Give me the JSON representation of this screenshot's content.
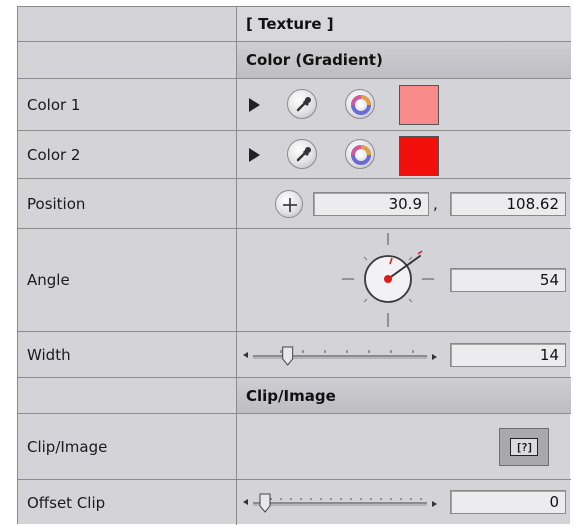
{
  "sections": {
    "texture_header": "[ Texture ]",
    "gradient_header": "Color (Gradient)",
    "clip_header": "Clip/Image"
  },
  "color1": {
    "label": "Color 1",
    "swatch_color": "#f98a8a"
  },
  "color2": {
    "label": "Color 2",
    "swatch_color": "#f10f0b"
  },
  "position": {
    "label": "Position",
    "x": "30.9",
    "separator": ",",
    "y": "108.62"
  },
  "angle": {
    "label": "Angle",
    "value": "54"
  },
  "width": {
    "label": "Width",
    "value": "14",
    "slider_fraction": 0.14
  },
  "clip_image": {
    "label": "Clip/Image",
    "button_glyph": "[?]"
  },
  "offset_clip": {
    "label": "Offset Clip",
    "value": "0",
    "slider_fraction": 0.0
  },
  "icons": {
    "disclosure": "disclosure-triangle-icon",
    "eyedropper": "eyedropper-icon",
    "color_wheel": "color-wheel-icon",
    "crosshair": "plus-crosshair-icon",
    "dial": "angle-dial-icon",
    "slider": "slider-icon",
    "image_well": "image-well-icon"
  }
}
